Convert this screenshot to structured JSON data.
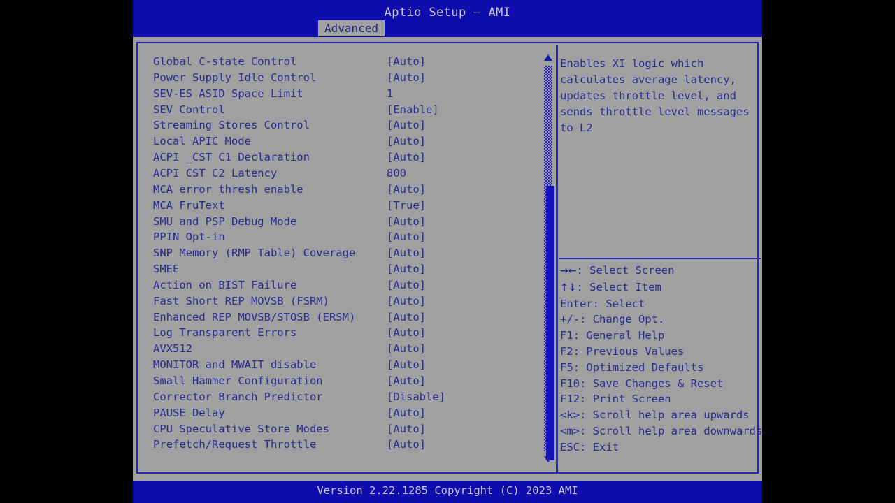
{
  "window": {
    "title": "Aptio Setup – AMI",
    "footer": "Version 2.22.1285 Copyright (C) 2023 AMI"
  },
  "tabs": [
    {
      "label": "Advanced",
      "active": true
    }
  ],
  "settings": {
    "rows": [
      {
        "label": "Global C-state Control",
        "value": "[Auto]"
      },
      {
        "label": "Power Supply Idle Control",
        "value": "[Auto]"
      },
      {
        "label": "SEV-ES ASID Space Limit",
        "value": "1"
      },
      {
        "label": "SEV Control",
        "value": "[Enable]"
      },
      {
        "label": "Streaming Stores Control",
        "value": "[Auto]"
      },
      {
        "label": "Local APIC Mode",
        "value": "[Auto]"
      },
      {
        "label": "ACPI _CST C1 Declaration",
        "value": "[Auto]"
      },
      {
        "label": "ACPI CST C2 Latency",
        "value": "800"
      },
      {
        "label": "MCA error thresh enable",
        "value": "[Auto]"
      },
      {
        "label": "MCA FruText",
        "value": "[True]"
      },
      {
        "label": "SMU and PSP Debug Mode",
        "value": "[Auto]"
      },
      {
        "label": "PPIN Opt-in",
        "value": "[Auto]"
      },
      {
        "label": "SNP Memory (RMP Table) Coverage",
        "value": "[Auto]"
      },
      {
        "label": "SMEE",
        "value": "[Auto]"
      },
      {
        "label": "Action on BIST Failure",
        "value": "[Auto]"
      },
      {
        "label": "Fast Short REP MOVSB (FSRM)",
        "value": "[Auto]"
      },
      {
        "label": "Enhanced REP MOVSB/STOSB (ERSM)",
        "value": "[Auto]"
      },
      {
        "label": "Log Transparent Errors",
        "value": "[Auto]"
      },
      {
        "label": "AVX512",
        "value": "[Auto]"
      },
      {
        "label": "MONITOR and MWAIT disable",
        "value": "[Auto]"
      },
      {
        "label": "Small Hammer Configuration",
        "value": "[Auto]"
      },
      {
        "label": "Corrector Branch Predictor",
        "value": "[Disable]"
      },
      {
        "label": "PAUSE Delay",
        "value": "[Auto]"
      },
      {
        "label": "CPU Speculative Store Modes",
        "value": "[Auto]"
      },
      {
        "label": "Prefetch/Request Throttle",
        "value": "[Auto]"
      }
    ]
  },
  "help": {
    "description_lines": [
      "Enables XI logic which",
      "calculates average latency,",
      "updates throttle level, and",
      "sends throttle level messages",
      "to L2"
    ],
    "keys": [
      {
        "glyph": "→←",
        "text": ": Select Screen"
      },
      {
        "glyph": "↑↓",
        "text": ": Select Item"
      },
      {
        "glyph": "",
        "text": "Enter: Select"
      },
      {
        "glyph": "",
        "text": "+/-: Change Opt."
      },
      {
        "glyph": "",
        "text": "F1: General Help"
      },
      {
        "glyph": "",
        "text": "F2: Previous Values"
      },
      {
        "glyph": "",
        "text": "F5: Optimized Defaults"
      },
      {
        "glyph": "",
        "text": "F10: Save Changes & Reset"
      },
      {
        "glyph": "",
        "text": "F12: Print Screen"
      },
      {
        "glyph": "",
        "text": "<k>: Scroll help area upwards"
      },
      {
        "glyph": "",
        "text": "<m>: Scroll help area downwards"
      },
      {
        "glyph": "",
        "text": "ESC: Exit"
      }
    ]
  },
  "scrollbar": {
    "up_arrow": "scroll-up-arrow",
    "down_arrow": "scroll-down-arrow"
  },
  "colors": {
    "background": "#000000",
    "panel": "#a0a0a0",
    "title_bar": "#0d0dad",
    "text": "#2a2a8f",
    "title_text": "#c8c8d8",
    "border": "#2626b0",
    "scroll_thumb": "#1212bb"
  }
}
